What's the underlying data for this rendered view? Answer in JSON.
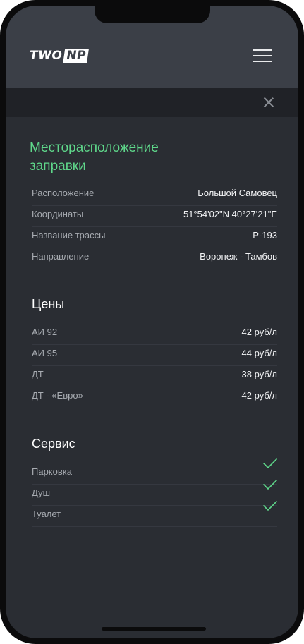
{
  "header": {
    "logo_left": "TWO",
    "logo_right": "NP"
  },
  "location": {
    "title": "Месторасположение заправки",
    "rows": [
      {
        "label": "Расположение",
        "value": "Большой Самовец"
      },
      {
        "label": "Координаты",
        "value": "51°54'02\"N 40°27'21\"E"
      },
      {
        "label": "Название трассы",
        "value": "Р-193"
      },
      {
        "label": "Направление",
        "value": "Воронеж - Тамбов"
      }
    ]
  },
  "prices": {
    "title": "Цены",
    "rows": [
      {
        "label": "АИ 92",
        "value": "42 руб/л"
      },
      {
        "label": "АИ 95",
        "value": "44 руб/л"
      },
      {
        "label": "ДТ",
        "value": "38 руб/л"
      },
      {
        "label": "ДТ - «Евро»",
        "value": "42 руб/л"
      }
    ]
  },
  "service": {
    "title": "Сервис",
    "rows": [
      {
        "label": "Парковка",
        "available": true,
        "icon": "check-icon"
      },
      {
        "label": "Душ",
        "available": true,
        "icon": "check-icon"
      },
      {
        "label": "Туалет",
        "available": true,
        "icon": "check-icon"
      }
    ]
  },
  "colors": {
    "accent_green": "#5fd88b",
    "header_bg": "#3b3f47",
    "screen_bg": "#2a2d33"
  }
}
